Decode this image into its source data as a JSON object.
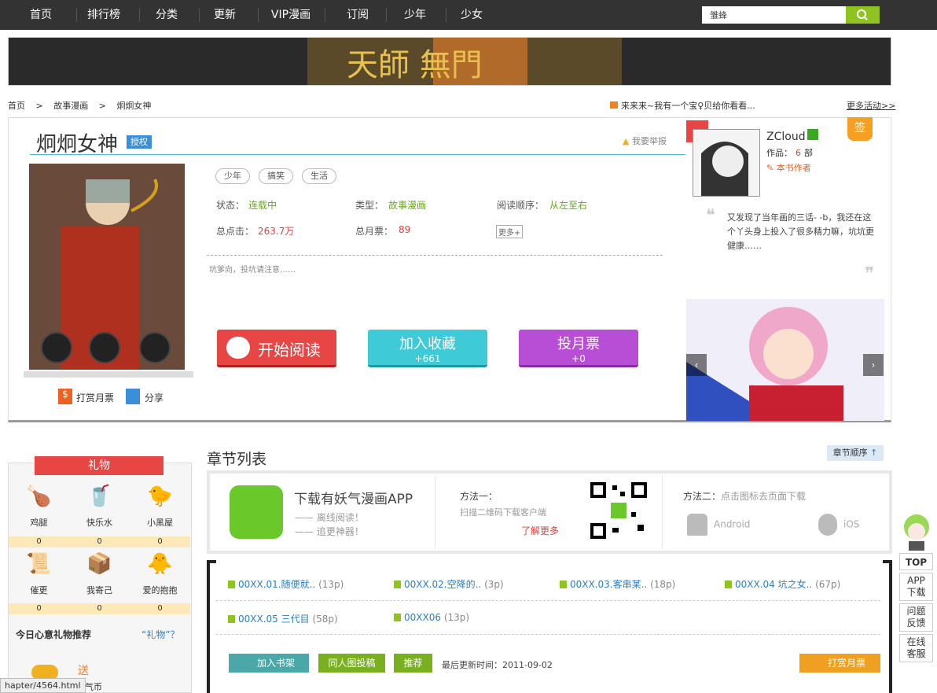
{
  "nav": {
    "items": [
      "首页",
      "排行榜",
      "分类",
      "更新",
      "VIP漫画",
      "订阅",
      "少年",
      "少女"
    ],
    "search_value": "雏蜂"
  },
  "banner": {
    "text": "天師 無門"
  },
  "breadcrumb": {
    "items": [
      "首页",
      "故事漫画",
      "炯炯女神"
    ],
    "sep": ">"
  },
  "notice": "来来来~我有一个宝♀贝给你看看...",
  "more_activity": "更多活动>>",
  "comic": {
    "title": "炯炯女神",
    "badge": "授权",
    "report": "我要举报",
    "tags": [
      "少年",
      "搞笑",
      "生活"
    ],
    "status_label": "状态：",
    "status": "连载中",
    "type_label": "类型：",
    "type": "故事漫画",
    "order_label": "阅读顺序：",
    "order": "从左至右",
    "clicks_label": "总点击：",
    "clicks": "263.7万",
    "votes_label": "总月票：",
    "votes": "89",
    "more": "更多+",
    "desc": "坑爹向，投坑请注意……",
    "reward": "打赏月票",
    "share": "分享"
  },
  "buttons": {
    "read": "开始阅读",
    "fav": "加入收藏",
    "fav_count": "+661",
    "vote": "投月票",
    "vote_count": "+0"
  },
  "author": {
    "name": "ZCloud",
    "works_label": "作品：",
    "works": "6",
    "works_unit": "部",
    "role": "本书作者",
    "sign": "签",
    "quote": "又发现了当年画的三话- -b，我还在这个丫头身上投入了很多精力嘛，坑坑更健康……"
  },
  "gifts": {
    "title": "礼物",
    "items": [
      {
        "name": "鸡腿",
        "count": "0"
      },
      {
        "name": "快乐水",
        "count": "0"
      },
      {
        "name": "小黑屋",
        "count": "0"
      },
      {
        "name": "催更",
        "count": "0"
      },
      {
        "name": "我寄己",
        "count": "0"
      },
      {
        "name": "爱的抱抱",
        "count": "0"
      }
    ],
    "today": "今日心意礼物推荐",
    "help": "“礼物”？",
    "send": "送",
    "coin": "妖气币"
  },
  "chapters": {
    "title": "章节列表",
    "order": "章节顺序",
    "app_title": "下载有妖气漫画APP",
    "app_line1": "—— 离线阅读！",
    "app_line2": "—— 追更神器！",
    "method1": "方法一：",
    "method1_desc": "扫描二维码下载客户端",
    "learn_more": "了解更多",
    "method2": "方法二：",
    "method2_desc": "点击图标去页面下载",
    "android": "Android",
    "ios": "iOS",
    "list": [
      {
        "t": "00XX.01.随便就..",
        "p": "(13p)"
      },
      {
        "t": "00XX.02.空降的..",
        "p": "(3p)"
      },
      {
        "t": "00XX.03.客串某..",
        "p": "(18p)"
      },
      {
        "t": "00XX.04 坑之女..",
        "p": "(67p)"
      },
      {
        "t": "00XX.05 三代目",
        "p": "(58p)"
      },
      {
        "t": "00XX06",
        "p": "(13p)"
      }
    ],
    "shelf": "加入书架",
    "submit": "同人图投稿",
    "recommend": "推荐",
    "updated": "最后更新时间：2011-09-02",
    "reward": "打赏月票"
  },
  "side": {
    "top": "TOP",
    "app": "APP下载",
    "feedback": "问题反馈",
    "service": "在线客服"
  },
  "status_url": "hapter/4564.html"
}
